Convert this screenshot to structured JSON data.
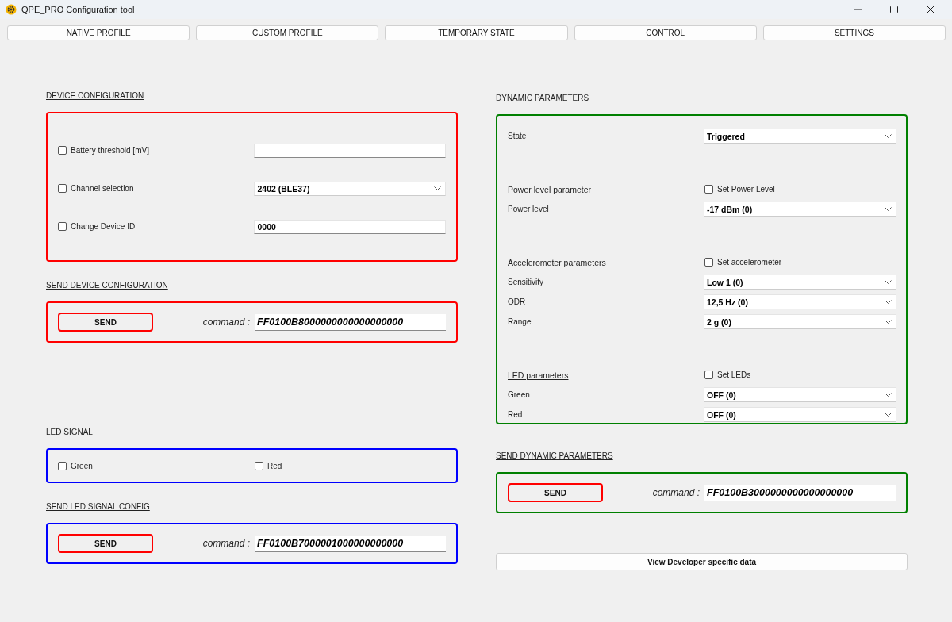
{
  "window": {
    "title": "QPE_PRO Configuration tool"
  },
  "tabs": [
    {
      "label": "NATIVE PROFILE"
    },
    {
      "label": "CUSTOM PROFILE"
    },
    {
      "label": "TEMPORARY STATE"
    },
    {
      "label": "CONTROL"
    },
    {
      "label": "SETTINGS"
    }
  ],
  "device_configuration": {
    "heading": "DEVICE CONFIGURATION",
    "color": "#ff0000",
    "rows": [
      {
        "label": "Battery threshold [mV]",
        "checked": false,
        "kind": "text"
      },
      {
        "label": "Channel selection",
        "checked": false,
        "kind": "select",
        "value": "2402 (BLE37)"
      },
      {
        "label": "Change Device ID",
        "checked": false,
        "kind": "text",
        "value": "0000"
      }
    ]
  },
  "send_device_configuration": {
    "heading": "SEND DEVICE CONFIGURATION",
    "color": "#ff0000",
    "button": "SEND",
    "command_label": "command :",
    "command": "FF0100B8000000000000000000"
  },
  "led_signal": {
    "heading": "LED SIGNAL",
    "color": "#0000ff",
    "options": [
      {
        "label": "Green",
        "checked": false
      },
      {
        "label": "Red",
        "checked": false
      }
    ]
  },
  "send_led_signal_config": {
    "heading": "SEND LED SIGNAL CONFIG",
    "color": "#0000ff",
    "button": "SEND",
    "command_label": "command :",
    "command": "FF0100B7000001000000000000"
  },
  "dynamic_parameters": {
    "heading": "DYNAMIC PARAMETERS",
    "color": "#008000",
    "groups": [
      {
        "rows": [
          {
            "label": "State",
            "value": "Triggered"
          }
        ]
      },
      {
        "title": "Power level parameter",
        "toggle": {
          "label": "Set Power Level",
          "checked": false
        },
        "rows": [
          {
            "label": "Power level",
            "value": "-17 dBm (0)"
          }
        ]
      },
      {
        "title": "Accelerometer parameters",
        "toggle": {
          "label": "Set accelerometer",
          "checked": false
        },
        "rows": [
          {
            "label": "Sensitivity",
            "value": "Low 1 (0)"
          },
          {
            "label": "ODR",
            "value": "12,5 Hz (0)"
          },
          {
            "label": "Range",
            "value": "2 g (0)"
          }
        ]
      },
      {
        "title": "LED parameters",
        "toggle": {
          "label": "Set LEDs",
          "checked": false
        },
        "rows": [
          {
            "label": "Green",
            "value": "OFF (0)"
          },
          {
            "label": "Red",
            "value": "OFF (0)"
          }
        ]
      }
    ]
  },
  "send_dynamic_parameters": {
    "heading": "SEND DYNAMIC PARAMETERS",
    "color": "#008000",
    "button": "SEND",
    "command_label": "command :",
    "command": "FF0100B3000000000000000000"
  },
  "developer_button": "View Developer specific data"
}
